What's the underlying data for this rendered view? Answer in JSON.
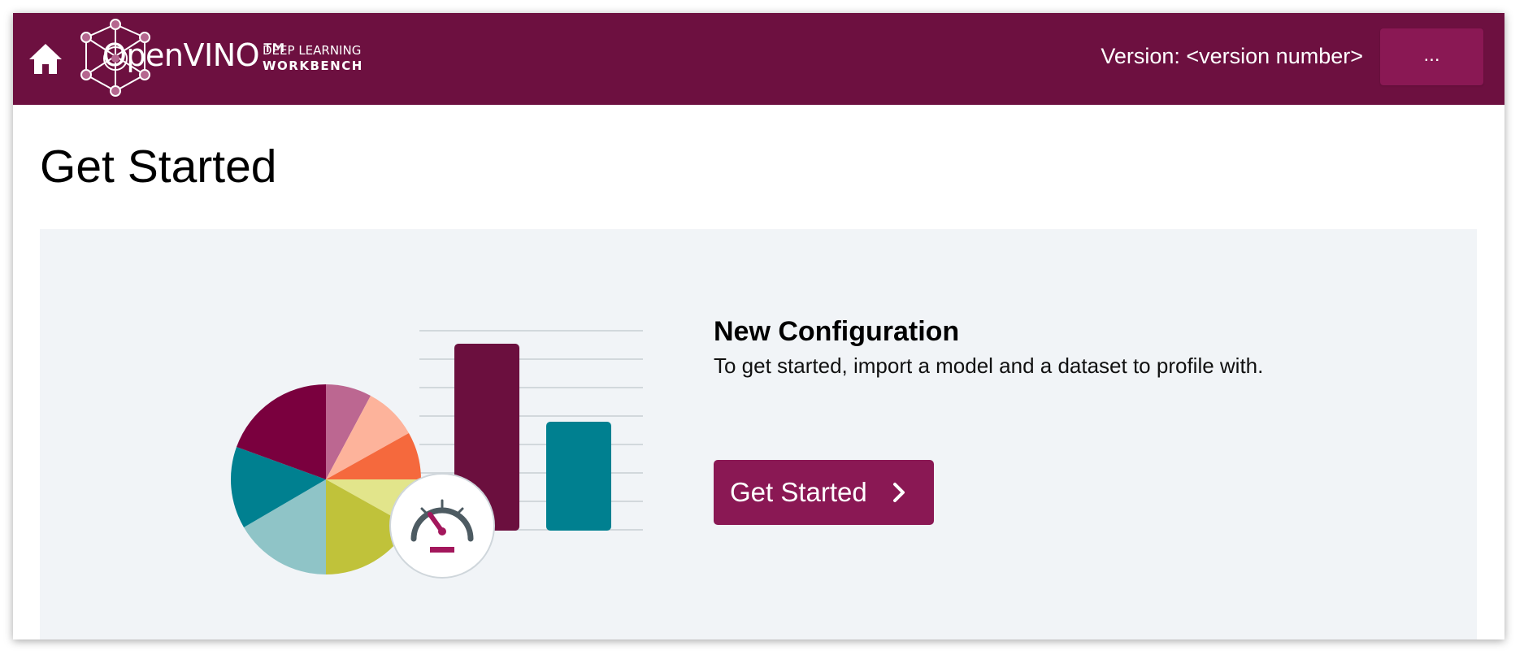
{
  "header": {
    "logo_text": "OpenVINO™",
    "logo_subtitle_1": "DEEP LEARNING",
    "logo_subtitle_2": "WORKBENCH",
    "version_text": "Version: <version number>",
    "menu_label": "..."
  },
  "icons": {
    "home": "home-icon",
    "logo": "openvino-network-logo-icon",
    "speedometer": "speedometer-icon",
    "chevron": "chevron-right-icon"
  },
  "page": {
    "title": "Get Started"
  },
  "new_configuration": {
    "title": "New Configuration",
    "description": "To get started, import a model and a dataset to profile with.",
    "button_label": "Get Started"
  },
  "colors": {
    "header_background": "#6d1040",
    "accent": "#8a1854",
    "panel_background": "#f1f4f7",
    "teal": "#008090",
    "dark_magenta": "#6b0f3e"
  }
}
